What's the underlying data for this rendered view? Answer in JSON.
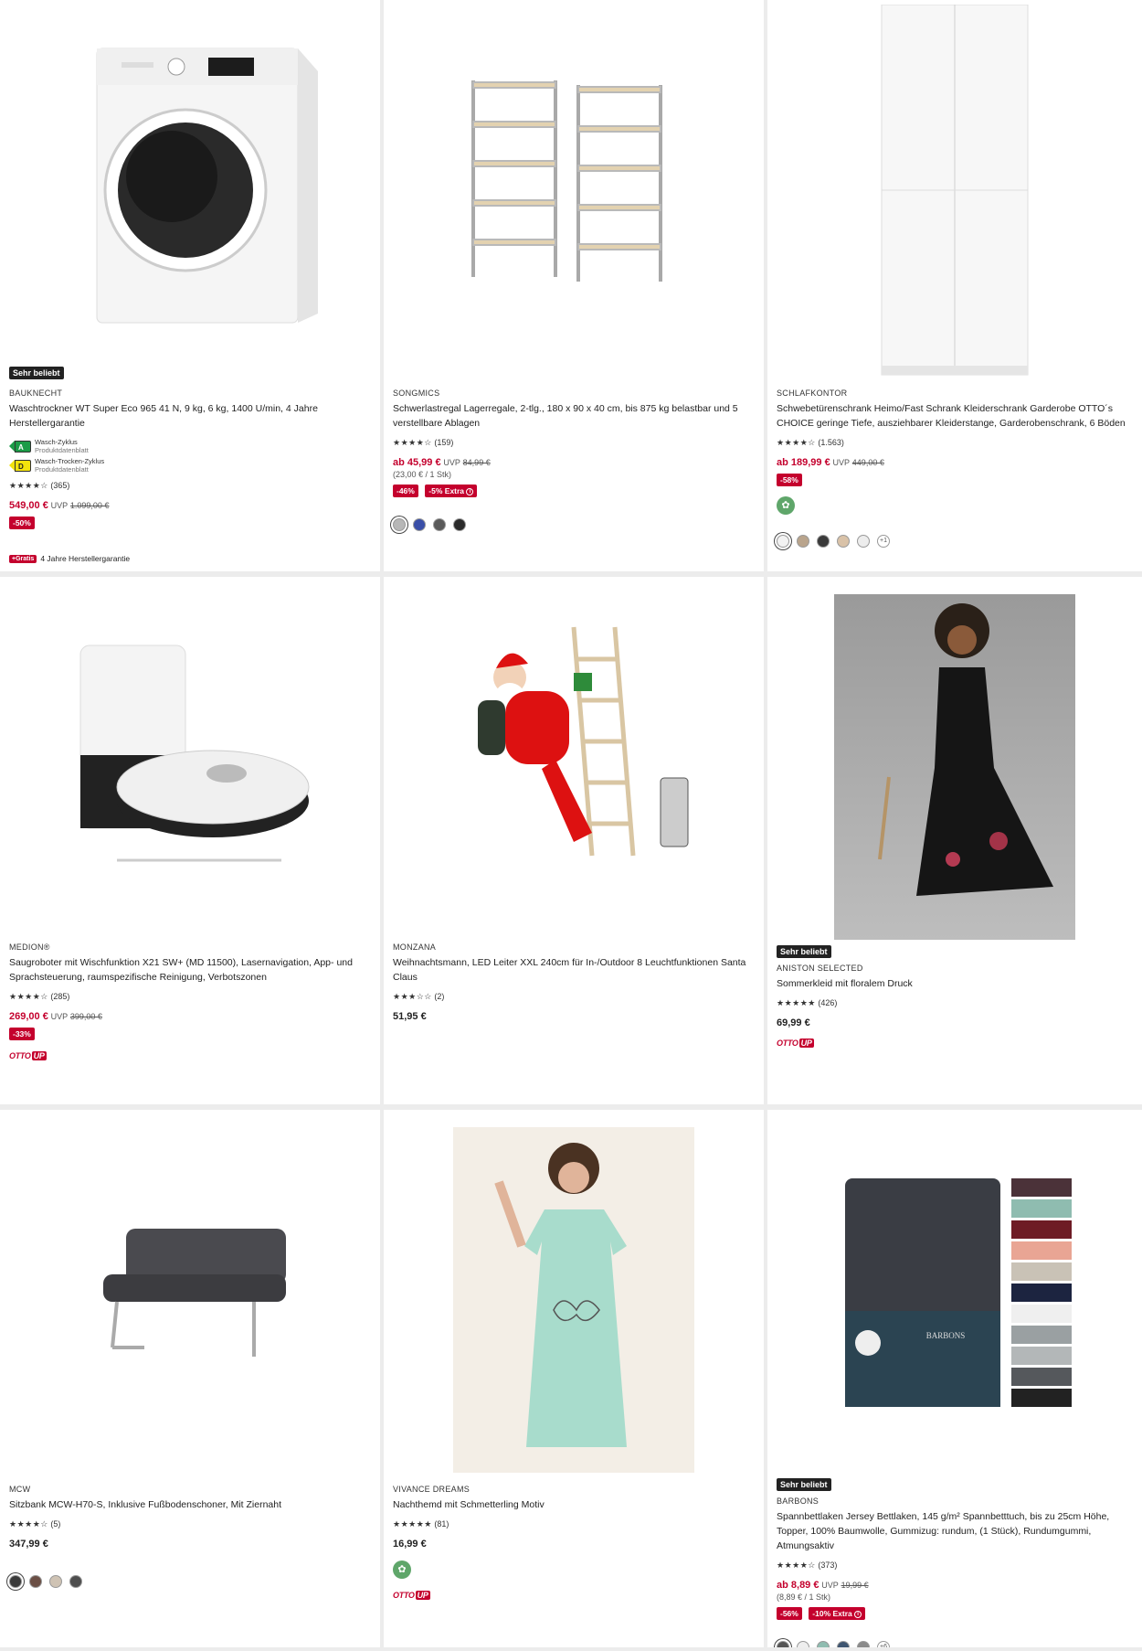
{
  "products": [
    {
      "badge": "Sehr beliebt",
      "brand": "BAUKNECHT",
      "title": "Waschtrockner WT Super Eco 965 41 N, 9 kg, 6 kg, 1400 U/min, 4 Jahre Herstellergarantie",
      "energy": [
        {
          "class": "A",
          "label": "Wasch-Zyklus",
          "sub": "Produktdatenblatt",
          "color": "#1b9b47"
        },
        {
          "class": "D",
          "label": "Wasch-Trocken-Zyklus",
          "sub": "Produktdatenblatt",
          "color": "#f2e20c"
        }
      ],
      "stars": "★★★★☆",
      "reviews": "(365)",
      "price": "549,00 €",
      "uvp_label": "UVP",
      "uvp": "1.099,00 €",
      "discount": "-50%",
      "gratis_badge": "+Gratis",
      "gratis_text": "4 Jahre Herstellergarantie"
    },
    {
      "brand": "SONGMICS",
      "title": "Schwerlastregal Lagerregale, 2-tlg., 180 x 90 x 40 cm, bis 875 kg belastbar und 5 verstellbare Ablagen",
      "stars": "★★★★☆",
      "reviews": "(159)",
      "price": "ab 45,99 €",
      "uvp_label": "UVP",
      "uvp": "84,99 €",
      "unit": "(23,00 € / 1 Stk)",
      "discount": "-46%",
      "extra": "-5% Extra",
      "swatches": [
        "#b7b7b7",
        "#3a4fa8",
        "#5a5a5a",
        "#2b2b2b"
      ]
    },
    {
      "brand": "SCHLAFKONTOR",
      "title": "Schwebetürenschrank Heimo/Fast Schrank Kleiderschrank Garderobe OTTO´s CHOICE geringe Tiefe, ausziehbarer Kleiderstange, Garderobenschrank, 6 Böden",
      "stars": "★★★★☆",
      "reviews": "(1.563)",
      "price": "ab 189,99 €",
      "uvp_label": "UVP",
      "uvp": "449,00 €",
      "discount": "-58%",
      "swatches": [
        "#f2f2f2",
        "#b9a48c",
        "#3a3a3a",
        "#d9c2a8",
        "#ededed"
      ],
      "more": "+1"
    },
    {
      "brand": "MEDION®",
      "title": "Saugroboter mit Wischfunktion X21 SW+ (MD 11500), Lasernavigation, App- und Sprachsteuerung, raumspezifische Reinigung, Verbotszonen",
      "stars": "★★★★☆",
      "reviews": "(285)",
      "price": "269,00 €",
      "uvp_label": "UVP",
      "uvp": "399,00 €",
      "discount": "-33%",
      "ottoup": "OTTO",
      "ottoup_up": "UP"
    },
    {
      "brand": "MONZANA",
      "title": "Weihnachtsmann, LED Leiter XXL 240cm für In-/Outdoor 8 Leuchtfunktionen Santa Claus",
      "stars": "★★★☆☆",
      "reviews": "(2)",
      "price": "51,95 €"
    },
    {
      "badge": "Sehr beliebt",
      "brand": "ANISTON SELECTED",
      "title": "Sommerkleid mit floralem Druck",
      "stars": "★★★★★",
      "reviews": "(426)",
      "price": "69,99 €",
      "ottoup": "OTTO",
      "ottoup_up": "UP"
    },
    {
      "brand": "MCW",
      "title": "Sitzbank MCW-H70-S, Inklusive Fußbodenschoner, Mit Ziernaht",
      "stars": "★★★★☆",
      "reviews": "(5)",
      "price": "347,99 €",
      "swatches": [
        "#3a3a3a",
        "#6b4f45",
        "#cfc3b4",
        "#4e4e4e"
      ]
    },
    {
      "brand": "VIVANCE DREAMS",
      "title": "Nachthemd mit Schmetterling Motiv",
      "stars": "★★★★★",
      "reviews": "(81)",
      "price": "16,99 €",
      "ottoup": "OTTO",
      "ottoup_up": "UP"
    },
    {
      "badge": "Sehr beliebt",
      "brand": "BARBONS",
      "title": "Spannbettlaken Jersey Bettlaken, 145 g/m² Spannbetttuch, bis zu 25cm Höhe, Topper, 100% Baumwolle, Gummizug: rundum, (1 Stück), Rundumgummi, Atmungsaktiv",
      "stars": "★★★★☆",
      "reviews": "(373)",
      "price": "ab 8,89 €",
      "uvp_label": "UVP",
      "uvp": "19,99 €",
      "unit": "(8,89 € / 1 Stk)",
      "discount": "-56%",
      "extra": "-10% Extra",
      "swatches": [
        "#555",
        "#eeeeee",
        "#8fbcb0",
        "#3e5570",
        "#8a8a8a"
      ],
      "more": "+6",
      "image_brand": "BARBONS"
    }
  ]
}
